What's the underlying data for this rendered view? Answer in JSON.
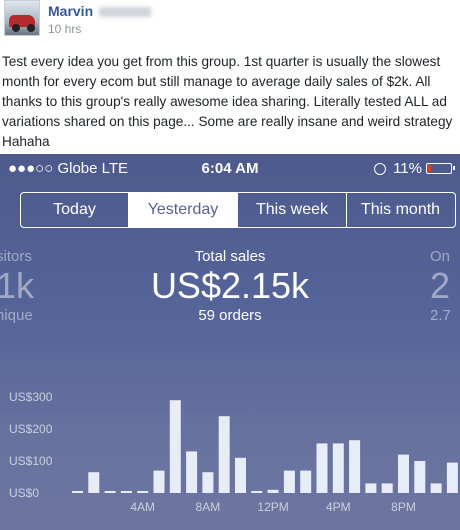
{
  "post": {
    "author": "Marvin",
    "time": "10 hrs",
    "lines": [
      "Test every idea you get from this group. 1st quarter is usually the slowest",
      "month for every ecom but still manage to average daily sales of $2k. All",
      "thanks to this group's really awesome idea sharing. Literally tested ALL ad",
      "variations shared on this page... Some are really insane and weird strategy",
      "Hahaha"
    ]
  },
  "status_bar": {
    "carrier": "●●●○○ Globe  LTE",
    "time": "6:04 AM",
    "battery": "11%"
  },
  "tabs": [
    {
      "label": "Today",
      "active": false
    },
    {
      "label": "Yesterday",
      "active": true
    },
    {
      "label": "This week",
      "active": false
    },
    {
      "label": "This month",
      "active": false
    }
  ],
  "metrics": {
    "left": {
      "label": "sitors",
      "value": "1k",
      "sub": "nique"
    },
    "center": {
      "label": "Total sales",
      "value": "US$2.15k",
      "sub": "59 orders"
    },
    "right": {
      "label": "On",
      "value": "2",
      "sub": "2.7"
    }
  },
  "colors": {
    "link": "#365899",
    "bar": "#e8ecf6",
    "active_tab_text": "#566295",
    "battery_low": "#e0421f"
  },
  "chart_data": {
    "type": "bar",
    "title": "",
    "xlabel": "",
    "ylabel": "",
    "ylim": [
      0,
      300
    ],
    "yticks": [
      "US$0",
      "US$100",
      "US$200",
      "US$300"
    ],
    "x_tick_labels": [
      {
        "hour": 4,
        "label": "4AM"
      },
      {
        "hour": 8,
        "label": "8AM"
      },
      {
        "hour": 12,
        "label": "12PM"
      },
      {
        "hour": 16,
        "label": "4PM"
      },
      {
        "hour": 20,
        "label": "8PM"
      }
    ],
    "hours": [
      0,
      1,
      2,
      3,
      4,
      5,
      6,
      7,
      8,
      9,
      10,
      11,
      12,
      13,
      14,
      15,
      16,
      17,
      18,
      19,
      20,
      21,
      22,
      23
    ],
    "values": [
      0,
      65,
      0,
      0,
      0,
      70,
      290,
      130,
      65,
      240,
      110,
      0,
      10,
      70,
      70,
      155,
      155,
      165,
      30,
      30,
      120,
      100,
      30,
      95
    ]
  }
}
